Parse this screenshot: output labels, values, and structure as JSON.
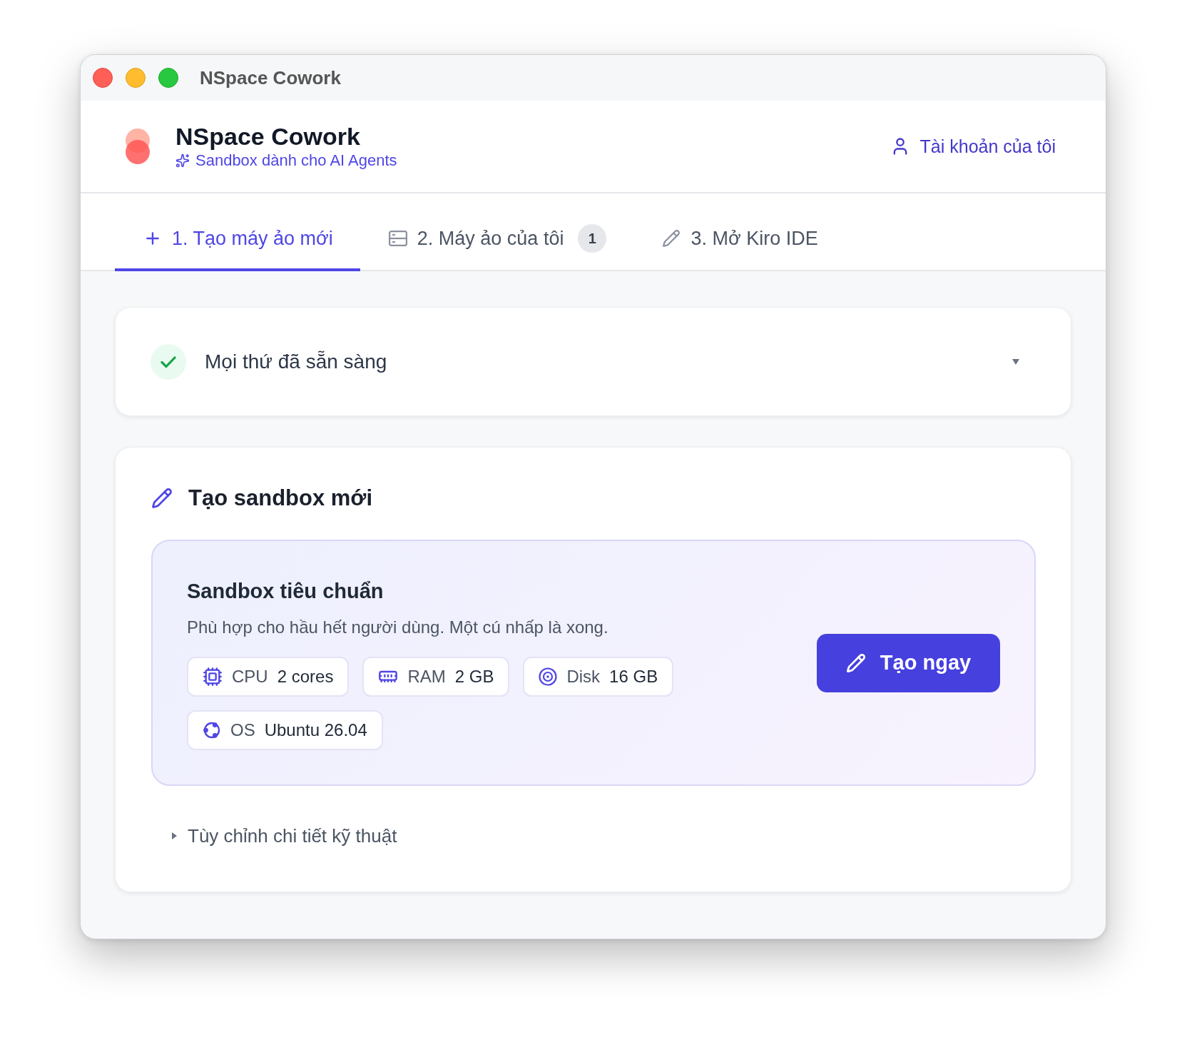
{
  "window": {
    "title": "NSpace Cowork"
  },
  "header": {
    "app_name": "NSpace Cowork",
    "tagline": "Sandbox dành cho AI Agents",
    "account_link": "Tài khoản của tôi"
  },
  "tabs": [
    {
      "label": "1. Tạo máy ảo mới",
      "selected": true
    },
    {
      "label": "2. Máy ảo của tôi",
      "selected": false,
      "badge": "1"
    },
    {
      "label": "3. Mở Kiro IDE",
      "selected": false
    }
  ],
  "status": {
    "text": "Mọi thứ đã sẵn sàng",
    "ready": true
  },
  "create": {
    "title": "Tạo sandbox mới",
    "preset": {
      "name": "Sandbox tiêu chuẩn",
      "description": "Phù hợp cho hầu hết người dùng. Một cú nhấp là xong.",
      "specs": [
        {
          "kind": "cpu",
          "label": "CPU",
          "value": "2 cores"
        },
        {
          "kind": "ram",
          "label": "RAM",
          "value": "2 GB"
        },
        {
          "kind": "disk",
          "label": "Disk",
          "value": "16 GB"
        },
        {
          "kind": "os",
          "label": "OS",
          "value": "Ubuntu 26.04"
        }
      ],
      "button": "Tạo ngay"
    },
    "advanced": {
      "label": "Tùy chỉnh chi tiết kỹ thuật",
      "expanded": false
    }
  }
}
